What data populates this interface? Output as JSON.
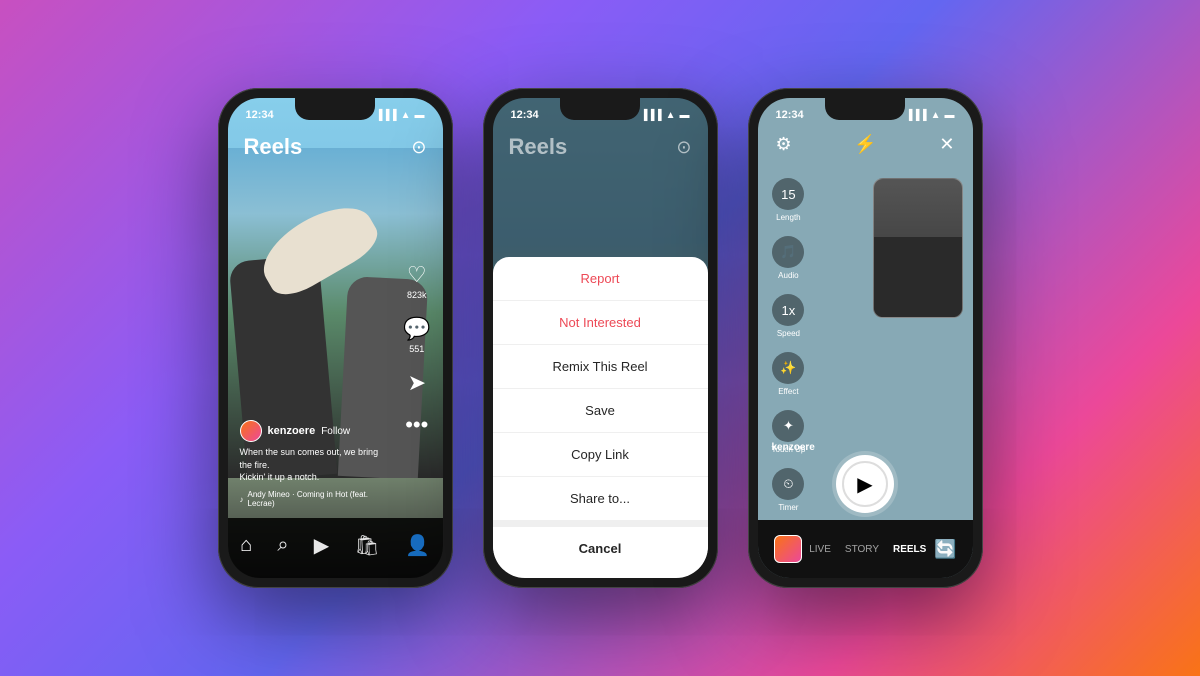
{
  "background": "linear-gradient(135deg, #c850c0 0%, #8b5cf6 30%, #6366f1 50%, #ec4899 80%, #f97316 100%)",
  "phone1": {
    "status_time": "12:34",
    "header_title": "Reels",
    "user": "kenzoere",
    "follow": "Follow",
    "likes": "823k",
    "comments": "551",
    "caption_line1": "When the sun comes out, we bring the fire.",
    "caption_line2": "Kickin' it up a notch.",
    "music": "Andy Mineo · Coming in Hot (feat. Lecrae)",
    "nav_items": [
      "home",
      "search",
      "reels",
      "shop",
      "profile"
    ]
  },
  "phone2": {
    "status_time": "12:34",
    "header_title": "Reels",
    "sheet_items": [
      {
        "label": "Report",
        "type": "danger"
      },
      {
        "label": "Not Interested",
        "type": "danger"
      },
      {
        "label": "Remix This Reel",
        "type": "normal"
      },
      {
        "label": "Save",
        "type": "normal"
      },
      {
        "label": "Copy Link",
        "type": "normal"
      },
      {
        "label": "Share to...",
        "type": "normal"
      }
    ],
    "cancel_label": "Cancel"
  },
  "phone3": {
    "status_time": "12:34",
    "controls": [
      {
        "icon": "⏱",
        "label": "Length",
        "value": "15"
      },
      {
        "icon": "🎵",
        "label": "Audio"
      },
      {
        "icon": "⚡",
        "label": "Speed"
      },
      {
        "icon": "✨",
        "label": "Effect"
      },
      {
        "icon": "✦",
        "label": "Touch Up"
      },
      {
        "icon": "⏲",
        "label": "Timer"
      }
    ],
    "username": "kenzoere",
    "modes": [
      {
        "label": "LIVE",
        "active": false
      },
      {
        "label": "STORY",
        "active": false
      },
      {
        "label": "REELS",
        "active": true
      }
    ]
  }
}
